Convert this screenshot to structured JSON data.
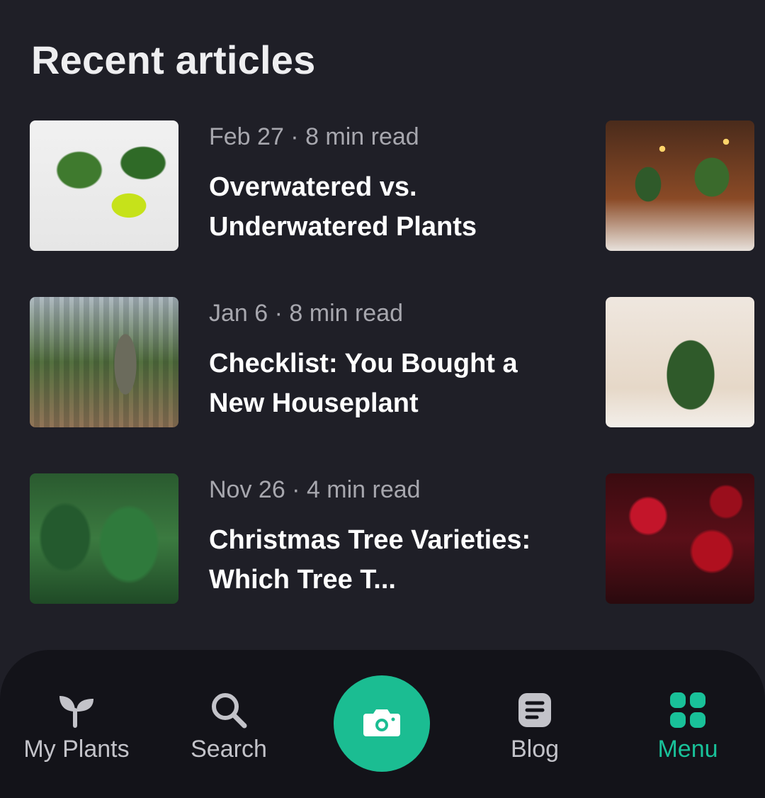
{
  "section": {
    "title": "Recent articles"
  },
  "articles": [
    {
      "meta": "Feb 27 · 8 min read",
      "title": "Overwatered vs. Underwatered Plants"
    },
    {
      "meta": "Jan 6 · 8 min read",
      "title": "Checklist: You Bought a New Houseplant"
    },
    {
      "meta": "Nov 26 · 4 min read",
      "title": "Christmas Tree Varieties: Which Tree T..."
    }
  ],
  "bottom_nav": {
    "items": [
      {
        "label": "My Plants",
        "icon": "sprout-icon"
      },
      {
        "label": "Search",
        "icon": "search-icon"
      },
      {
        "label": "Blog",
        "icon": "document-icon"
      },
      {
        "label": "Menu",
        "icon": "grid-icon",
        "active": true
      }
    ],
    "camera": {
      "icon": "camera-icon"
    }
  },
  "colors": {
    "accent": "#19c199",
    "background": "#1f1f27",
    "nav_background": "#131319"
  }
}
